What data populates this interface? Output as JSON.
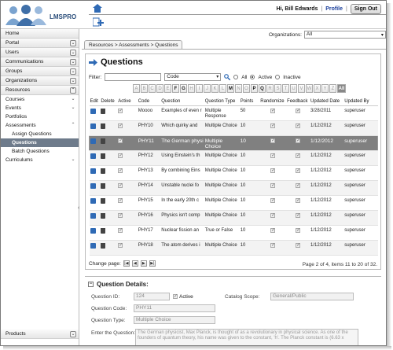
{
  "app": {
    "logo_text": "LMSPRO"
  },
  "user": {
    "greeting": "Hi, Bill Edwards",
    "separator": "|",
    "profile_label": "Profile",
    "signout_label": "Sign Out"
  },
  "sidebar": {
    "items": [
      {
        "label": "Home",
        "has_chevron": false
      },
      {
        "label": "Portal",
        "has_chevron": true
      },
      {
        "label": "Users",
        "has_chevron": true
      },
      {
        "label": "Communications",
        "has_chevron": true
      },
      {
        "label": "Groups",
        "has_chevron": true
      },
      {
        "label": "Organizations",
        "has_chevron": true
      },
      {
        "label": "Resources",
        "has_chevron": true
      }
    ],
    "resources_sub": {
      "courses": "Courses",
      "events": "Events",
      "portfolios": "Portfolios",
      "assessments": "Assessments",
      "assign_questions": "Assign Questions",
      "questions": "Questions",
      "batch_questions": "Batch Questions",
      "curriculums": "Curriculums"
    },
    "bottom": {
      "products": "Products"
    }
  },
  "breadcrumb": "Resources > Assessments > Questions",
  "organizations": {
    "label": "Organizations:",
    "value": "All"
  },
  "page": {
    "title": "Questions"
  },
  "filter": {
    "label": "Filter:",
    "field_value": "",
    "field_select": "Code",
    "status_options": [
      "All",
      "Active",
      "Inactive"
    ],
    "status_selected": "Active"
  },
  "letters": [
    "A",
    "B",
    "C",
    "D",
    "E",
    "F",
    "G",
    "H",
    "I",
    "J",
    "K",
    "L",
    "M",
    "N",
    "O",
    "P",
    "Q",
    "R",
    "S",
    "T",
    "U",
    "V",
    "W",
    "X",
    "Y",
    "Z",
    "All"
  ],
  "letters_bold": [
    "F",
    "G",
    "M",
    "P",
    "Q",
    "All"
  ],
  "table": {
    "headers": [
      "Edit",
      "Delete",
      "Active",
      "Code",
      "Question",
      "Question Type",
      "Points",
      "Randomize",
      "Feedback",
      "Updated Date",
      "Updated By"
    ],
    "rows": [
      {
        "code": "Moooo",
        "question": "Examples of even r",
        "type": "Multiple Response",
        "points": "50",
        "date": "3/28/2011",
        "by": "superuser",
        "selected": false
      },
      {
        "code": "PHY10",
        "question": "Which quirky and",
        "type": "Multiple Choice",
        "points": "10",
        "date": "1/12/2012",
        "by": "superuser",
        "selected": false
      },
      {
        "code": "PHY11",
        "question": "The German physi",
        "type": "Multiple Choice",
        "points": "10",
        "date": "1/12/2012",
        "by": "superuser",
        "selected": true
      },
      {
        "code": "PHY12",
        "question": "Using Einstein's th",
        "type": "Multiple Choice",
        "points": "10",
        "date": "1/12/2012",
        "by": "superuser",
        "selected": false
      },
      {
        "code": "PHY13",
        "question": "By combining Eins",
        "type": "Multiple Choice",
        "points": "10",
        "date": "1/12/2012",
        "by": "superuser",
        "selected": false
      },
      {
        "code": "PHY14",
        "question": "Unstable nuclei fo",
        "type": "Multiple Choice",
        "points": "10",
        "date": "1/12/2012",
        "by": "superuser",
        "selected": false
      },
      {
        "code": "PHY15",
        "question": "In the early 20th c",
        "type": "Multiple Choice",
        "points": "10",
        "date": "1/12/2012",
        "by": "superuser",
        "selected": false
      },
      {
        "code": "PHY16",
        "question": "Physics isn't comp",
        "type": "Multiple Choice",
        "points": "10",
        "date": "1/12/2012",
        "by": "superuser",
        "selected": false
      },
      {
        "code": "PHY17",
        "question": "Nuclear fission an",
        "type": "True or False",
        "points": "10",
        "date": "1/12/2012",
        "by": "superuser",
        "selected": false
      },
      {
        "code": "PHY18",
        "question": "The atom derives i",
        "type": "Multiple Choice",
        "points": "10",
        "date": "1/12/2012",
        "by": "superuser",
        "selected": false
      }
    ]
  },
  "pager": {
    "label": "Change page:",
    "info": "Page 2 of 4, items 11 to 20 of 32."
  },
  "details": {
    "title": "Question Details:",
    "question_id_label": "Question ID:",
    "question_id": "124",
    "active_label": "Active",
    "catalog_label": "Catalog Scope:",
    "catalog_value": "General/Public",
    "code_label": "Question Code:",
    "code_value": "PHY11",
    "type_label": "Question Type:",
    "type_value": "Multiple Choice",
    "enter_label": "Enter the Question:",
    "question_text": "The German physicist, Max Planck, is thought of as a revolutionary in physical science. As one of the founders of quantum theory, his name was given to the constant, 'h'. The Planck constant is (6.63 x"
  },
  "colors": {
    "selected_row": "#808080",
    "active_sidebar": "#6e7b8b",
    "profile_link": "#1b3f9b"
  }
}
